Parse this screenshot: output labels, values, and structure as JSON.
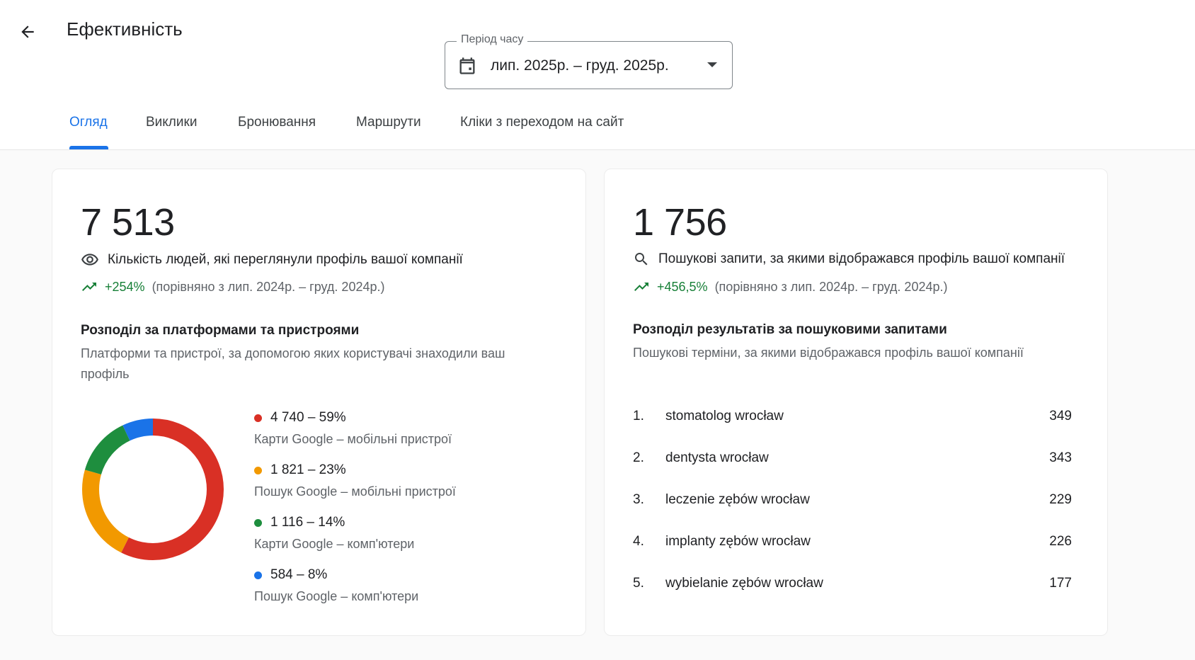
{
  "header": {
    "title": "Ефективність",
    "back_icon": "arrow-back-icon",
    "period": {
      "label": "Період часу",
      "value": "лип. 2025р. – груд. 2025р.",
      "icon": "calendar-icon"
    }
  },
  "tabs": [
    {
      "label": "Огляд",
      "active": true
    },
    {
      "label": "Виклики",
      "active": false
    },
    {
      "label": "Бронювання",
      "active": false
    },
    {
      "label": "Маршрути",
      "active": false
    },
    {
      "label": "Кліки з переходом на сайт",
      "active": false
    }
  ],
  "views_card": {
    "value": "7 513",
    "icon": "eye-icon",
    "description": "Кількість людей, які переглянули профіль вашої компанії",
    "trend_pct": "+254%",
    "trend_note": "(порівняно з лип. 2024р. – груд. 2024р.)",
    "breakdown_title": "Розподіл за платформами та пристроями",
    "breakdown_subtitle": "Платформи та пристрої, за допомогою яких користувачі знаходили ваш профіль",
    "legend": [
      {
        "value_label": "4 740 – 59%",
        "desc": "Карти Google – мобільні пристрої",
        "color": "#d93025"
      },
      {
        "value_label": "1 821 – 23%",
        "desc": "Пошук Google – мобільні пристрої",
        "color": "#f29900"
      },
      {
        "value_label": "1 116 – 14%",
        "desc": "Карти Google – комп'ютери",
        "color": "#1e8e3e"
      },
      {
        "value_label": "584 – 8%",
        "desc": "Пошук Google – комп'ютери",
        "color": "#1a73e8"
      }
    ]
  },
  "chart_data": {
    "type": "pie",
    "categories": [
      "Карти Google – мобільні пристрої",
      "Пошук Google – мобільні пристрої",
      "Карти Google – комп'ютери",
      "Пошук Google – комп'ютери"
    ],
    "values": [
      4740,
      1821,
      1116,
      584
    ],
    "colors": [
      "#d93025",
      "#f29900",
      "#1e8e3e",
      "#1a73e8"
    ]
  },
  "search_card": {
    "value": "1 756",
    "icon": "search-icon",
    "description": "Пошукові запити, за якими відображався профіль вашої компанії",
    "trend_pct": "+456,5%",
    "trend_note": "(порівняно з лип. 2024р. – груд. 2024р.)",
    "breakdown_title": "Розподіл результатів за пошуковими запитами",
    "breakdown_subtitle": "Пошукові терміни, за якими відображався профіль вашої компанії",
    "queries": [
      {
        "rank": "1.",
        "term": "stomatolog wrocław",
        "count": "349"
      },
      {
        "rank": "2.",
        "term": "dentysta wrocław",
        "count": "343"
      },
      {
        "rank": "3.",
        "term": "leczenie zębów wrocław",
        "count": "229"
      },
      {
        "rank": "4.",
        "term": "implanty zębów wrocław",
        "count": "226"
      },
      {
        "rank": "5.",
        "term": "wybielanie zębów wrocław",
        "count": "177"
      }
    ]
  }
}
